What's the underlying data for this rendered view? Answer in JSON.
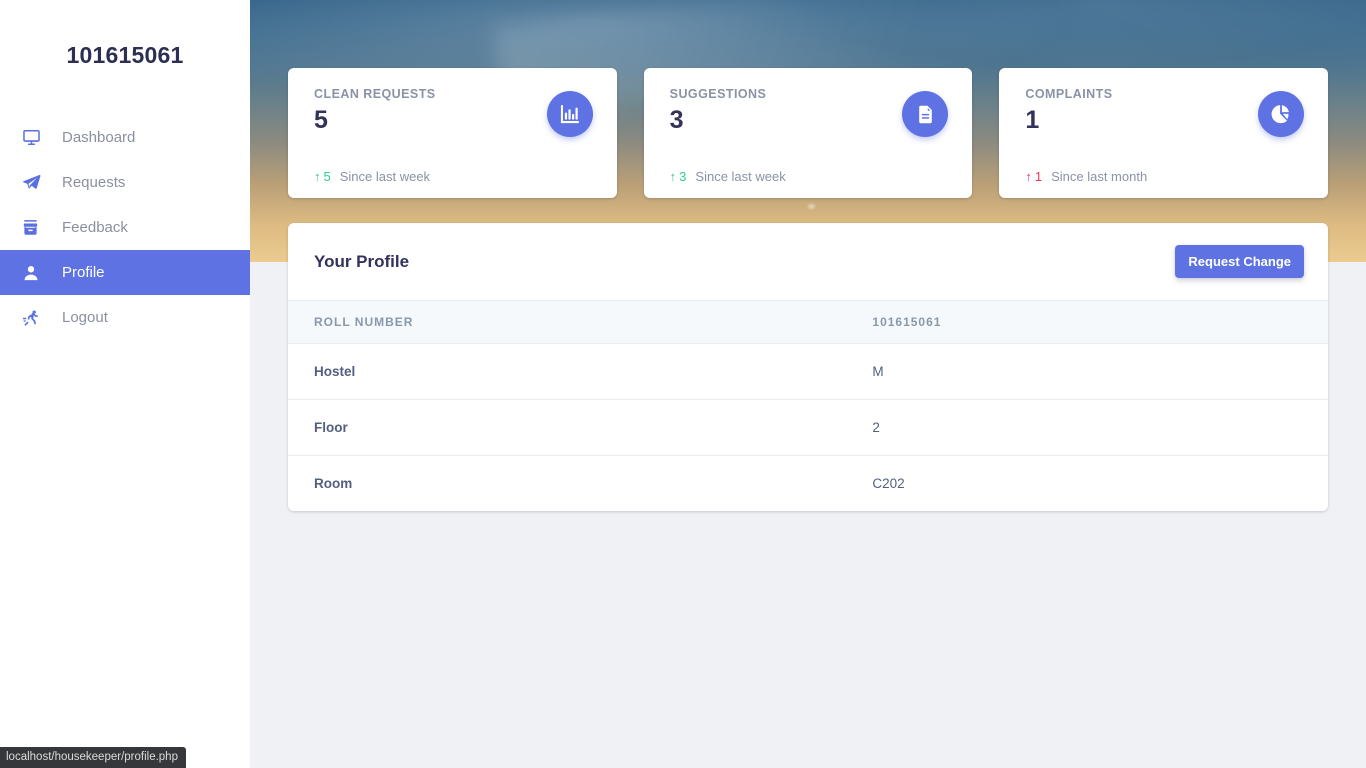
{
  "sidebar": {
    "brand": "101615061",
    "items": [
      {
        "label": "Dashboard",
        "icon": "monitor-icon",
        "active": false
      },
      {
        "label": "Requests",
        "icon": "paper-plane-icon",
        "active": false
      },
      {
        "label": "Feedback",
        "icon": "archive-box-icon",
        "active": false
      },
      {
        "label": "Profile",
        "icon": "user-icon",
        "active": true
      },
      {
        "label": "Logout",
        "icon": "running-person-icon",
        "active": false
      }
    ]
  },
  "cards": [
    {
      "title": "CLEAN REQUESTS",
      "value": "5",
      "icon": "bar-chart-icon",
      "delta": "5",
      "delta_direction": "up",
      "delta_arrow": "↑",
      "period": "Since last week"
    },
    {
      "title": "SUGGESTIONS",
      "value": "3",
      "icon": "document-icon",
      "delta": "3",
      "delta_direction": "up",
      "delta_arrow": "↑",
      "period": "Since last week"
    },
    {
      "title": "COMPLAINTS",
      "value": "1",
      "icon": "pie-chart-icon",
      "delta": "1",
      "delta_direction": "down",
      "delta_arrow": "↑",
      "period": "Since last month"
    }
  ],
  "panel": {
    "title": "Your Profile",
    "action_label": "Request Change",
    "header_row": {
      "key": "ROLL NUMBER",
      "value": "101615061"
    },
    "rows": [
      {
        "key": "Hostel",
        "value": "M"
      },
      {
        "key": "Floor",
        "value": "2"
      },
      {
        "key": "Room",
        "value": "C202"
      }
    ]
  },
  "statusbar": {
    "url": "localhost/housekeeper/profile.php"
  },
  "colors": {
    "accent": "#5e72e4",
    "sidebar_active": "#5e72e4",
    "up": "#2dce89",
    "down": "#f5365c",
    "heading": "#32325d",
    "muted": "#8a92a6",
    "page_bg": "#eff1f5"
  }
}
